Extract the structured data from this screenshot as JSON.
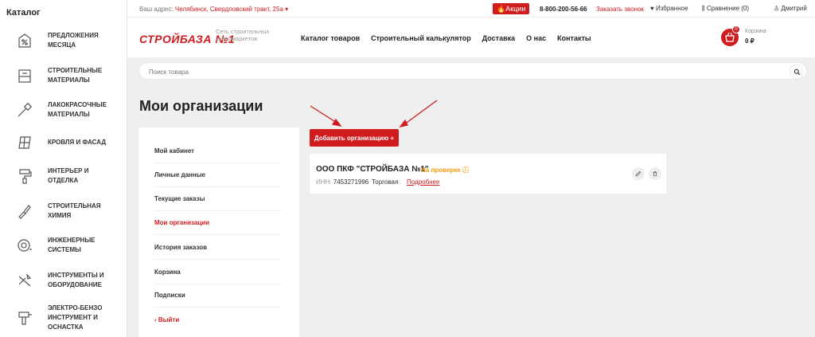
{
  "sidebar": {
    "title": "Каталог",
    "items": [
      {
        "label": "ПРЕДЛОЖЕНИЯ МЕСЯЦА",
        "icon": "percent-tag-icon"
      },
      {
        "label": "СТРОИТЕЛЬНЫЕ МАТЕРИАЛЫ",
        "icon": "building-materials-icon"
      },
      {
        "label": "ЛАКОКРАСОЧНЫЕ МАТЕРИАЛЫ",
        "icon": "paint-brush-icon"
      },
      {
        "label": "КРОВЛЯ И ФАСАД",
        "icon": "roof-icon"
      },
      {
        "label": "ИНТЕРЬЕР И ОТДЕЛКА",
        "icon": "paint-roller-icon"
      },
      {
        "label": "СТРОИТЕЛЬНАЯ ХИМИЯ",
        "icon": "spray-gun-icon"
      },
      {
        "label": "ИНЖЕНЕРНЫЕ СИСТЕМЫ",
        "icon": "pipe-valve-icon"
      },
      {
        "label": "ИНСТРУМЕНТЫ И ОБОРУДОВАНИЕ",
        "icon": "tools-icon"
      },
      {
        "label": "ЭЛЕКТРО-БЕНЗО ИНСТРУМЕНТ И ОСНАСТКА",
        "icon": "drill-icon"
      }
    ]
  },
  "topbar": {
    "address_prefix": "Ваш адрес:",
    "address_city": "Челябинск, Свердловский тракт, 25а ▾",
    "promo": "🔥Акции",
    "phone": "8-800-200-56-66",
    "callback": "Заказать звонок",
    "favorites": "♥ Избранное",
    "compare": "⫼ Сравнение (0)",
    "user": "♙ Дмитрий"
  },
  "header": {
    "logo": "СТРОЙБАЗА №1",
    "tagline": "Сеть строительных супермаркетов",
    "nav": [
      "Каталог товаров",
      "Строительный калькулятор",
      "Доставка",
      "О нас",
      "Контакты"
    ],
    "cart_label": "Корзина",
    "cart_sum": "0 ₽",
    "cart_count": "0"
  },
  "search": {
    "placeholder": "Поиск товара"
  },
  "page": {
    "title": "Мои организации"
  },
  "account_menu": {
    "items": [
      "Мой кабинет",
      "Личные данные",
      "Текущие заказы",
      "Мои организации",
      "История заказов",
      "Корзина",
      "Подписки",
      "‹ Выйти"
    ],
    "active": "Мои организации"
  },
  "add_button": {
    "label": "Добавить организацию +"
  },
  "organization": {
    "name": "ООО ПКФ \"СТРОЙБАЗА №1\"",
    "status": "На проверке ⓘ",
    "inn_label": "ИНН:",
    "inn": "7453271996",
    "type": "Торговая",
    "details_link": "Подробнее"
  },
  "colors": {
    "accent": "#d01c1f",
    "status": "#f39c12",
    "background": "#efefef"
  }
}
